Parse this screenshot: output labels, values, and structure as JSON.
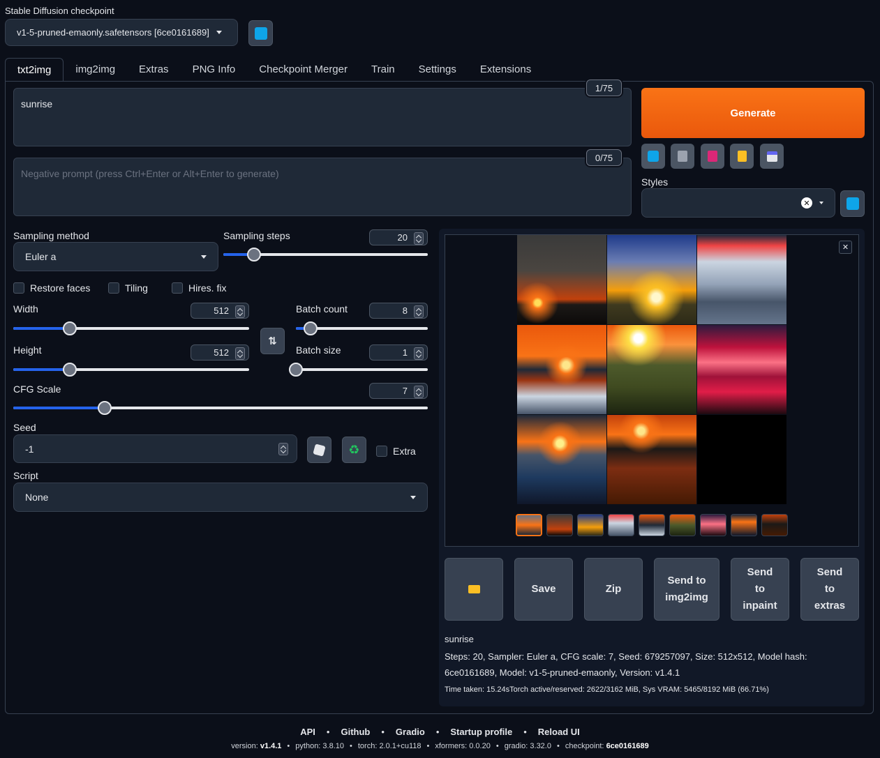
{
  "checkpoint": {
    "label": "Stable Diffusion checkpoint",
    "selected": "v1-5-pruned-emaonly.safetensors [6ce0161689]"
  },
  "tabs": [
    "txt2img",
    "img2img",
    "Extras",
    "PNG Info",
    "Checkpoint Merger",
    "Train",
    "Settings",
    "Extensions"
  ],
  "prompt": {
    "value": "sunrise",
    "counter": "1/75"
  },
  "negative_prompt": {
    "placeholder": "Negative prompt (press Ctrl+Enter or Alt+Enter to generate)",
    "counter": "0/75"
  },
  "generate_label": "Generate",
  "styles_label": "Styles",
  "sampling": {
    "method_label": "Sampling method",
    "method_value": "Euler a",
    "steps_label": "Sampling steps",
    "steps_value": "20",
    "steps_fraction": 0.15
  },
  "checkboxes": {
    "restore_faces": "Restore faces",
    "tiling": "Tiling",
    "hires_fix": "Hires. fix",
    "extra": "Extra"
  },
  "width": {
    "label": "Width",
    "value": "512",
    "fraction": 0.24
  },
  "height": {
    "label": "Height",
    "value": "512",
    "fraction": 0.24
  },
  "batch_count": {
    "label": "Batch count",
    "value": "8",
    "fraction": 0.11
  },
  "batch_size": {
    "label": "Batch size",
    "value": "1",
    "fraction": 0.0
  },
  "cfg": {
    "label": "CFG Scale",
    "value": "7",
    "fraction": 0.22
  },
  "seed": {
    "label": "Seed",
    "value": "-1"
  },
  "script": {
    "label": "Script",
    "value": "None"
  },
  "actions": {
    "save": "Save",
    "zip": "Zip",
    "send_img2img": "Send to img2img",
    "send_inpaint": "Send to inpaint",
    "send_extras": "Send to extras"
  },
  "info": {
    "prompt": "sunrise",
    "params": "Steps: 20, Sampler: Euler a, CFG scale: 7, Seed: 679257097, Size: 512x512, Model hash: 6ce0161689, Model: v1-5-pruned-emaonly, Version: v1.4.1",
    "time": "Time taken: 15.24sTorch active/reserved: 2622/3162 MiB, Sys VRAM: 5465/8192 MiB (66.71%)"
  },
  "footer": {
    "links": [
      "API",
      "Github",
      "Gradio",
      "Startup profile",
      "Reload UI"
    ],
    "version_label": "version:",
    "version": "v1.4.1",
    "python": "python: 3.8.10",
    "torch": "torch: 2.0.1+cu118",
    "xformers": "xformers: 0.0.20",
    "gradio": "gradio: 3.32.0",
    "checkpoint_label": "checkpoint:",
    "checkpoint": "6ce0161689"
  },
  "colors": {
    "accent": "#ea580c",
    "slider_fill": "#2563eb",
    "bg": "#0b0f19",
    "surface": "#1f2937"
  }
}
